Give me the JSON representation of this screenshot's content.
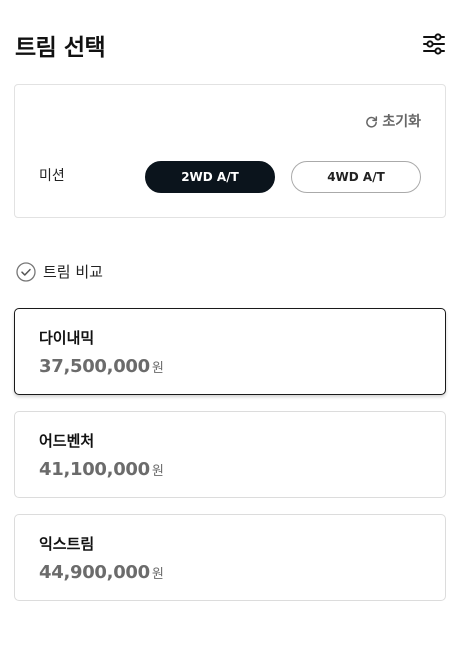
{
  "header": {
    "title": "트림 선택",
    "filter_icon": "sliders-icon"
  },
  "options": {
    "reset_label": "초기화",
    "reset_icon": "refresh-icon",
    "mission_label": "미션",
    "mission_options": [
      {
        "label": "2WD A/T",
        "selected": true
      },
      {
        "label": "4WD A/T",
        "selected": false
      }
    ]
  },
  "compare": {
    "label": "트림 비교",
    "icon": "check-circle-icon"
  },
  "trims": [
    {
      "name": "다이내믹",
      "price": "37,500,000",
      "unit": "원",
      "selected": true
    },
    {
      "name": "어드벤처",
      "price": "41,100,000",
      "unit": "원",
      "selected": false
    },
    {
      "name": "익스트림",
      "price": "44,900,000",
      "unit": "원",
      "selected": false
    }
  ],
  "colors": {
    "accent_dark": "#0b141c",
    "price_gray": "#6b6b6b",
    "border": "#dcdcdc"
  }
}
